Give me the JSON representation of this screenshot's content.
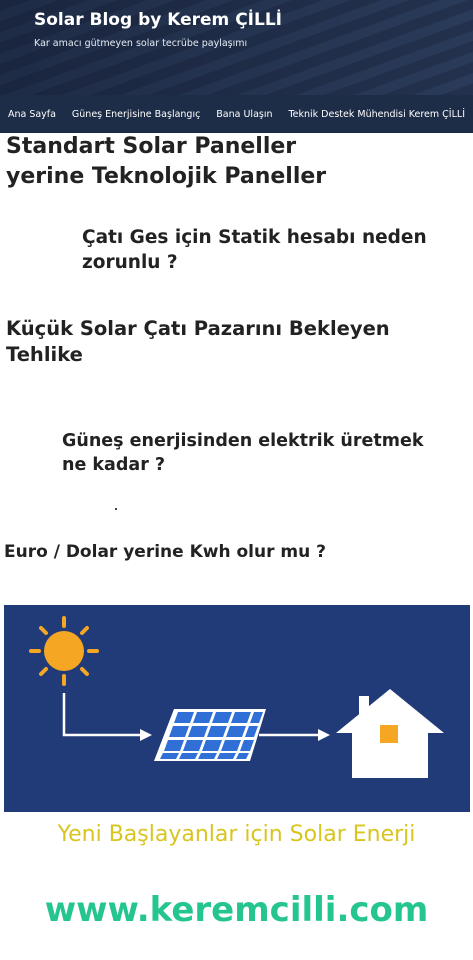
{
  "header": {
    "title": "Solar Blog by Kerem ÇİLLİ",
    "tagline": "Kar amacı gütmeyen solar tecrübe paylaşımı"
  },
  "nav": {
    "items": [
      {
        "label": "Ana Sayfa"
      },
      {
        "label": "Güneş Enerjisine Başlangıç"
      },
      {
        "label": "Bana Ulaşın"
      },
      {
        "label": "Teknik Destek Mühendisi Kerem ÇİLLİ"
      }
    ]
  },
  "articles": [
    {
      "title_line1": "Standart Solar Paneller",
      "title_line2": "yerine Teknolojik Paneller"
    },
    {
      "title_line1": "Çatı Ges için Statik hesabı neden",
      "title_line2": "zorunlu ?"
    },
    {
      "title_line1": "Küçük Solar Çatı Pazarını Bekleyen",
      "title_line2": "Tehlike"
    },
    {
      "title_line1": "Güneş enerjisinden elektrik üretmek",
      "title_line2": "ne kadar ?"
    },
    {
      "title_line1": "Euro / Dolar yerine Kwh olur mu ?"
    }
  ],
  "banner": {
    "caption": "Yeni Başlayanlar için Solar Enerji",
    "url": "www.keremcilli.com",
    "icons": [
      "sun-icon",
      "solar-panel-icon",
      "house-icon",
      "arrow-icon"
    ],
    "colors": {
      "background": "#213a78",
      "sun": "#f5a623",
      "panel": "#2f6fd6",
      "house": "#ffffff",
      "window": "#f5a623"
    }
  }
}
